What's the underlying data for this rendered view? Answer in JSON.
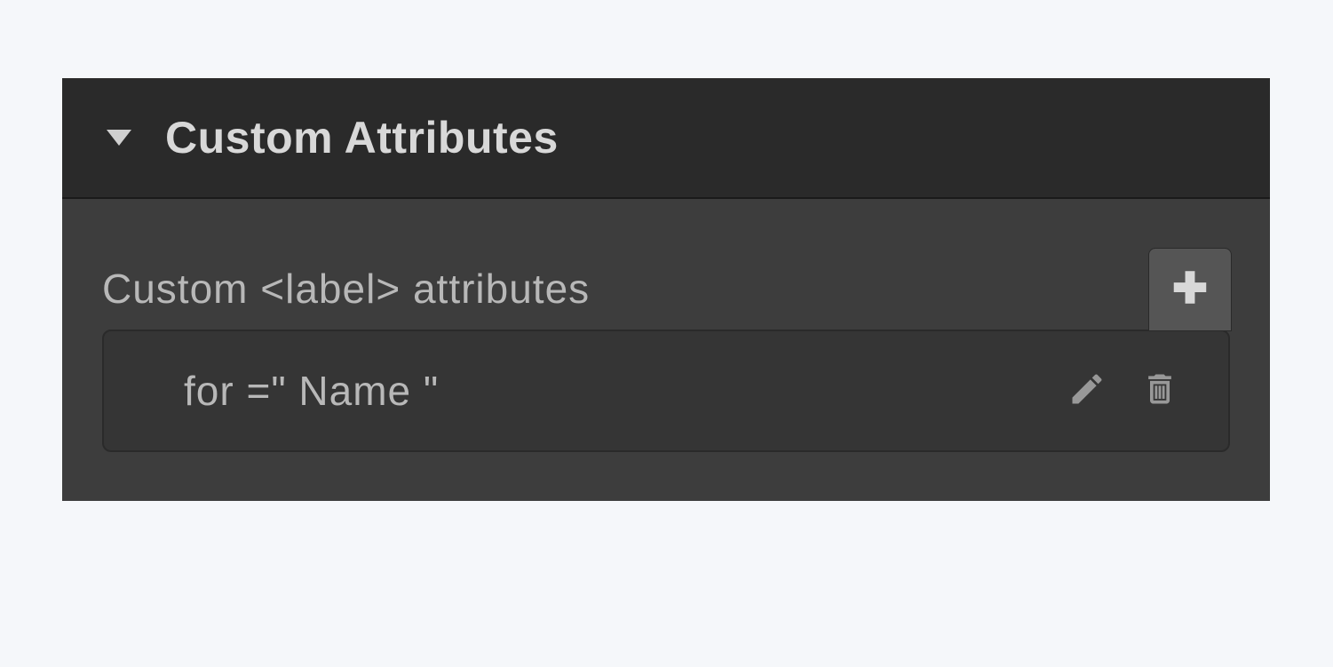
{
  "panel": {
    "title": "Custom Attributes",
    "body_label": "Custom <label> attributes",
    "attributes": [
      {
        "text": "for =\" Name \""
      }
    ]
  }
}
